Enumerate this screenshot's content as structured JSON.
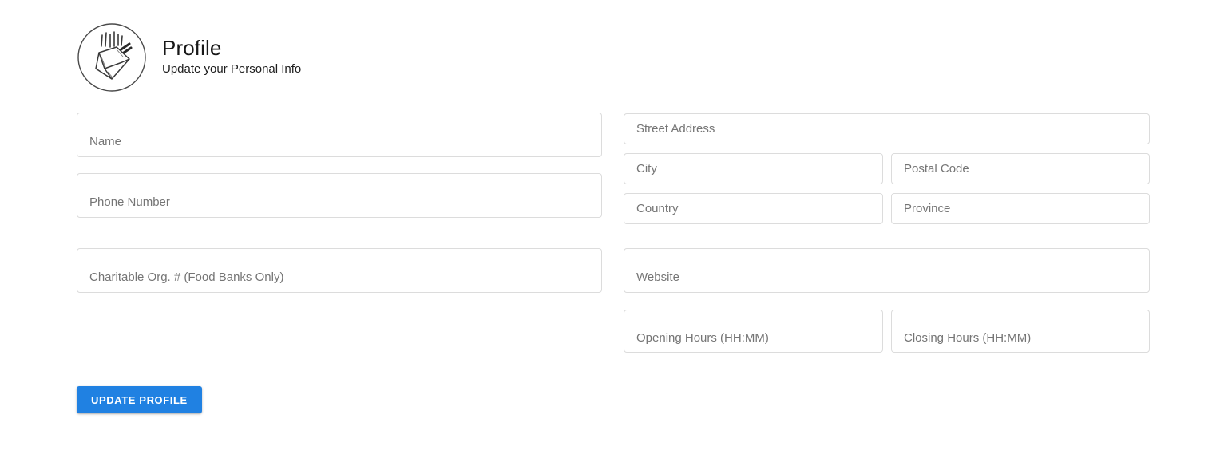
{
  "header": {
    "logo_icon": "takeout-box-chopsticks-icon",
    "title": "Profile",
    "subtitle": "Update your Personal Info"
  },
  "form": {
    "left_column": [
      {
        "name": "name",
        "placeholder": "Name",
        "value": ""
      },
      {
        "name": "phone-number",
        "placeholder": "Phone Number",
        "value": ""
      },
      {
        "name": "charitable-org-number",
        "placeholder": "Charitable Org. # (Food Banks Only)",
        "value": ""
      }
    ],
    "right_column": [
      {
        "name": "street-address",
        "placeholder": "Street Address",
        "value": ""
      },
      {
        "name": "city",
        "placeholder": "City",
        "value": ""
      },
      {
        "name": "postal-code",
        "placeholder": "Postal Code",
        "value": ""
      },
      {
        "name": "country",
        "placeholder": "Country",
        "value": ""
      },
      {
        "name": "province",
        "placeholder": "Province",
        "value": ""
      },
      {
        "name": "website",
        "placeholder": "Website",
        "value": ""
      },
      {
        "name": "opening-hours",
        "placeholder": "Opening Hours (HH:MM)",
        "value": ""
      },
      {
        "name": "closing-hours",
        "placeholder": "Closing Hours (HH:MM)",
        "value": ""
      }
    ]
  },
  "actions": {
    "update_profile_label": "Update Profile"
  },
  "colors": {
    "primary_button": "#2081e2",
    "field_border": "#dcdcdc",
    "placeholder_text": "#757575",
    "page_background": "#ffffff",
    "title_text": "#181818"
  }
}
